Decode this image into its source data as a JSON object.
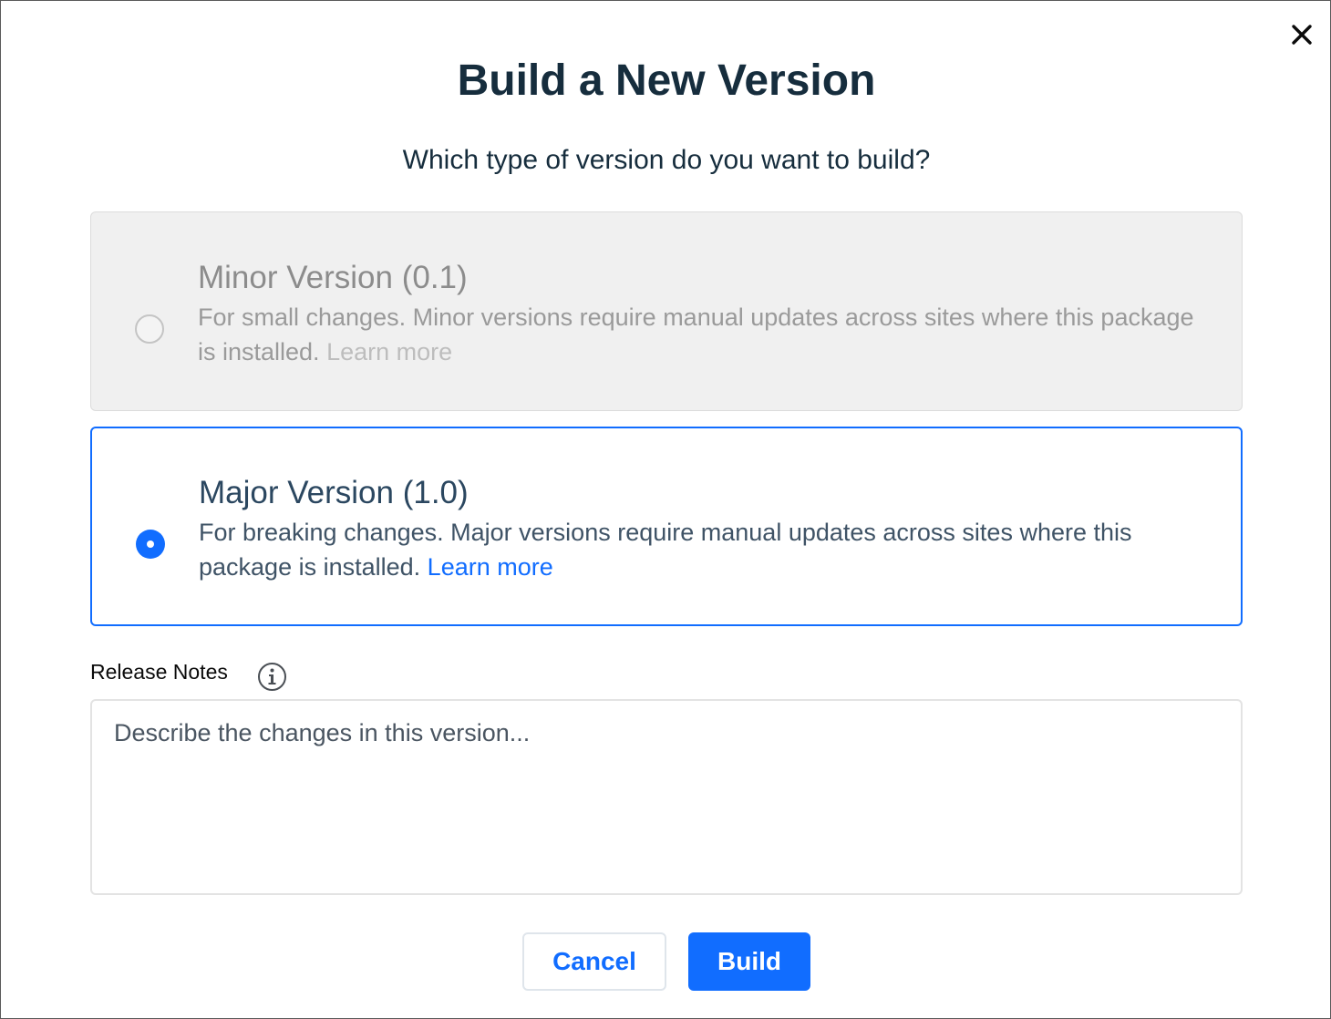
{
  "dialog": {
    "title": "Build a New Version",
    "subtitle": "Which type of version do you want to build?",
    "close_icon": "close-icon"
  },
  "options": [
    {
      "title": "Minor Version (0.1)",
      "description": "For small changes. Minor versions require manual updates across sites where this package is installed.",
      "learn_more": "Learn more",
      "selected": false,
      "disabled": true
    },
    {
      "title": "Major Version (1.0)",
      "description": "For breaking changes. Major versions require manual updates across sites where this package is installed.",
      "learn_more": "Learn more",
      "selected": true,
      "disabled": false
    }
  ],
  "release_notes": {
    "label": "Release Notes",
    "info_icon": "info-icon",
    "placeholder": "Describe the changes in this version...",
    "value": ""
  },
  "buttons": {
    "cancel": "Cancel",
    "build": "Build"
  },
  "colors": {
    "accent": "#116dff",
    "title": "#162d3d",
    "disabled_bg": "#f0f0f0"
  }
}
